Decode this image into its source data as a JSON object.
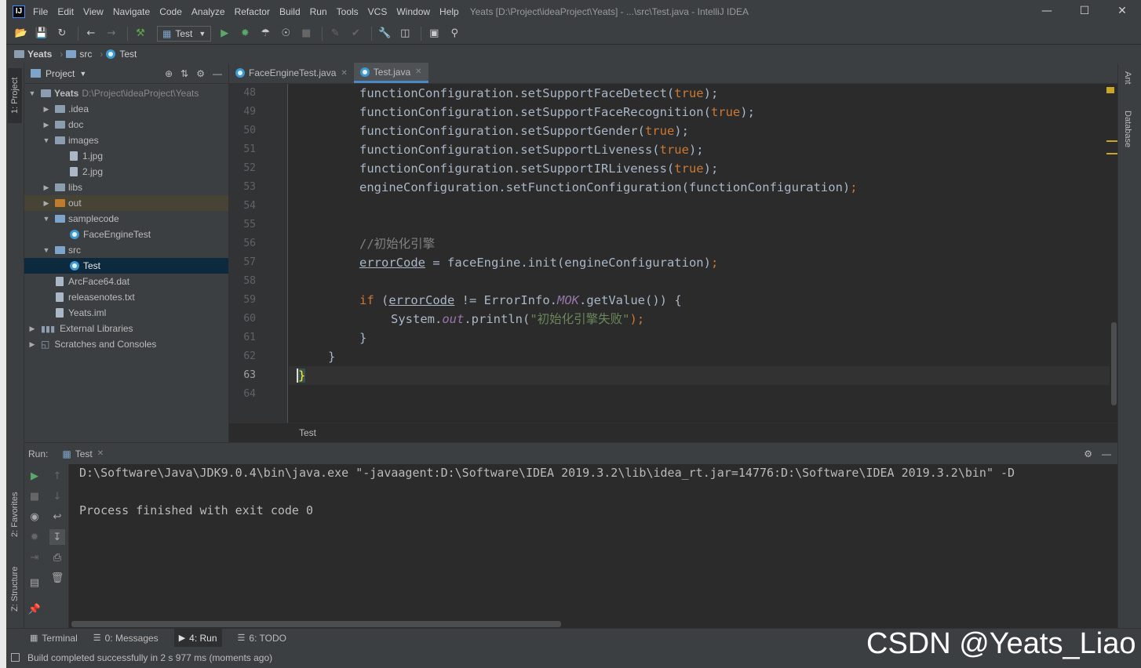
{
  "window": {
    "title": "Yeats [D:\\Project\\ideaProject\\Yeats] - ...\\src\\Test.java - IntelliJ IDEA",
    "logo": "IJ"
  },
  "menu": [
    "File",
    "Edit",
    "View",
    "Navigate",
    "Code",
    "Analyze",
    "Refactor",
    "Build",
    "Run",
    "Tools",
    "VCS",
    "Window",
    "Help"
  ],
  "toolbar": {
    "run_config": "Test"
  },
  "breadcrumb": [
    "Yeats",
    "src",
    "Test"
  ],
  "project_panel": {
    "title": "Project",
    "root": {
      "name": "Yeats",
      "path": "D:\\Project\\ideaProject\\Yeats"
    },
    "items": [
      {
        "label": ".idea"
      },
      {
        "label": "doc"
      },
      {
        "label": "images"
      },
      {
        "label": "1.jpg"
      },
      {
        "label": "2.jpg"
      },
      {
        "label": "libs"
      },
      {
        "label": "out"
      },
      {
        "label": "samplecode"
      },
      {
        "label": "FaceEngineTest"
      },
      {
        "label": "src"
      },
      {
        "label": "Test"
      },
      {
        "label": "ArcFace64.dat"
      },
      {
        "label": "releasenotes.txt"
      },
      {
        "label": "Yeats.iml"
      },
      {
        "label": "External Libraries"
      },
      {
        "label": "Scratches and Consoles"
      }
    ]
  },
  "left_tabs": {
    "project": "1: Project",
    "favorites": "2: Favorites",
    "structure": "Z: Structure"
  },
  "right_tabs": {
    "ant": "Ant",
    "database": "Database"
  },
  "editor": {
    "tabs": [
      {
        "label": "FaceEngineTest.java"
      },
      {
        "label": "Test.java"
      }
    ],
    "line_numbers": [
      "48",
      "49",
      "50",
      "51",
      "52",
      "53",
      "54",
      "55",
      "56",
      "57",
      "58",
      "59",
      "60",
      "61",
      "62",
      "63",
      "64"
    ],
    "code": {
      "l48": {
        "a": "functionConfiguration.setSupportFaceDetect(",
        "b": "true",
        "c": ");"
      },
      "l49": {
        "a": "functionConfiguration.setSupportFaceRecognition(",
        "b": "true",
        "c": ");"
      },
      "l50": {
        "a": "functionConfiguration.setSupportGender(",
        "b": "true",
        "c": ");"
      },
      "l51": {
        "a": "functionConfiguration.setSupportLiveness(",
        "b": "true",
        "c": ");"
      },
      "l52": {
        "a": "functionConfiguration.setSupportIRLiveness(",
        "b": "true",
        "c": ");"
      },
      "l53": {
        "a": "engineConfiguration.setFunctionConfiguration(functionConfiguration)",
        "c": ";"
      },
      "l56": {
        "comment": "//初始化引擎"
      },
      "l57": {
        "a": "errorCode",
        "b": " = faceEngine.init(engineConfiguration)",
        "c": ";"
      },
      "l59": {
        "kw": "if",
        "a": " (",
        "var": "errorCode",
        "b": " != ErrorInfo.",
        "const": "MOK",
        "c": ".getValue()) {"
      },
      "l60": {
        "a": "System.",
        "out": "out",
        "b": ".println(",
        "str": "\"初始化引擎失败\"",
        "c": ");"
      },
      "l61": {
        "a": "}"
      },
      "l62": {
        "a": "}"
      },
      "l63": {
        "a": "}"
      }
    },
    "footer_label": "Test"
  },
  "run_panel": {
    "label": "Run:",
    "tab": "Test",
    "console": [
      "D:\\Software\\Java\\JDK9.0.4\\bin\\java.exe \"-javaagent:D:\\Software\\IDEA 2019.3.2\\lib\\idea_rt.jar=14776:D:\\Software\\IDEA 2019.3.2\\bin\" -D",
      "",
      "Process finished with exit code 0"
    ]
  },
  "bottom_tabs": [
    {
      "label": "Terminal"
    },
    {
      "label": "0: Messages"
    },
    {
      "label": "4: Run"
    },
    {
      "label": "6: TODO"
    }
  ],
  "status": {
    "message": "Build completed successfully in 2 s 977 ms (moments ago)"
  },
  "watermark": "CSDN @Yeats_Liao"
}
